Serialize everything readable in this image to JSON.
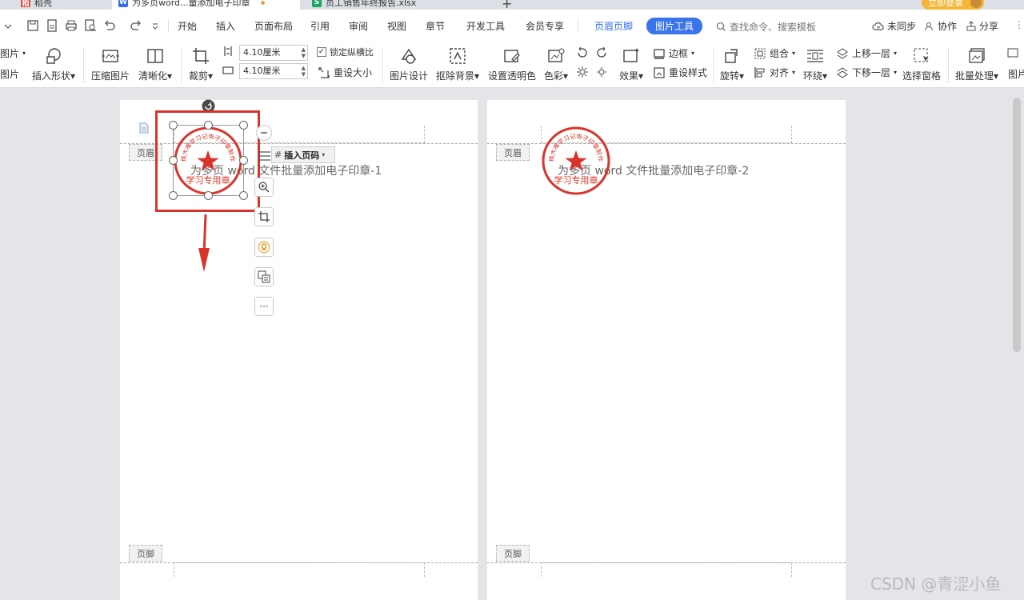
{
  "tabs": [
    {
      "label": "稻壳"
    },
    {
      "label": "为多页word...量添加电子印章"
    },
    {
      "label": "员工销售年终报告.xlsx"
    }
  ],
  "login_label": "立即登录",
  "menu": {
    "items": [
      "开始",
      "插入",
      "页面布局",
      "引用",
      "审阅",
      "视图",
      "章节",
      "开发工具",
      "会员专享",
      "页眉页脚",
      "图片工具"
    ],
    "active_index": 10,
    "search_placeholder": "查找命令、搜索模板",
    "unsynced": "未同步",
    "collab": "协作",
    "share": "分享"
  },
  "ribbon": {
    "pic_label": "图片",
    "shape_label": "插入形状",
    "compress": "压缩图片",
    "clarify": "清晰化",
    "crop": "裁剪",
    "width": "4.10厘米",
    "height": "4.10厘米",
    "lock_ratio": "锁定纵横比",
    "reset_size": "重设大小",
    "pic_design": "图片设计",
    "remove_bg": "抠除背景",
    "set_transparent": "设置透明色",
    "color": "色彩",
    "effect": "效果",
    "border": "边框",
    "reset_style": "重设样式",
    "rotate": "旋转",
    "group": "组合",
    "align": "对齐",
    "wrap": "环绕",
    "bring_forward": "上移一层",
    "send_backward": "下移一层",
    "select_pane": "选择窗格",
    "batch": "批量处理"
  },
  "pages": [
    {
      "header_tag": "页眉",
      "footer_tag": "页脚",
      "header_text": "为多页 word 文件批量添加电子印章-1"
    },
    {
      "header_tag": "页眉",
      "footer_tag": "页脚",
      "header_text": "为多页 word 文件批量添加电子印章-2"
    }
  ],
  "insert_page_number": "插入页码",
  "stamp": {
    "ring_text": "桃大嘴学习记电子印章制作",
    "bottom_text": "学习专用章",
    "color": "#d9342b"
  },
  "watermark": "CSDN @青涩小鱼",
  "colors": {
    "accent": "#3a74ea",
    "annotation": "#d9342b"
  }
}
